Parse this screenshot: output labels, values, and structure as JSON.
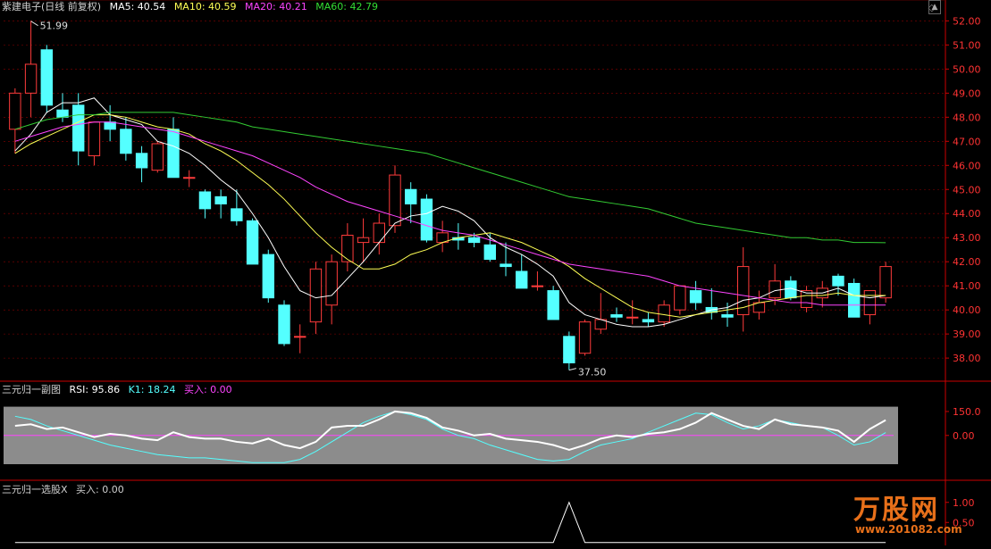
{
  "title": {
    "stock": "紫建电子(日线 前复权)",
    "ma5_label": "MA5: 40.54",
    "ma10_label": "MA10: 40.59",
    "ma20_label": "MA20: 40.21",
    "ma60_label": "MA60: 42.79"
  },
  "sub1": {
    "name": "三元归一副图",
    "rsi": "RSI: 95.86",
    "k1": "K1: 18.24",
    "buy": "买入: 0.00"
  },
  "sub2": {
    "name": "三元归一选股X",
    "buy": "买入: 0.00"
  },
  "brand": {
    "name": "万股网",
    "url": "www.201082.com"
  },
  "colors": {
    "up": "#ff3b3b",
    "down": "#54ffff",
    "ma5": "#ffffff",
    "ma10": "#ffff55",
    "ma20": "#ff44ff",
    "ma60": "#33cc33",
    "axis": "#cc0000"
  },
  "chart_data": [
    {
      "type": "candlestick",
      "title": "紫建电子(日线 前复权)",
      "y_ticks": [
        "52.00",
        "51.00",
        "50.00",
        "49.00",
        "48.00",
        "47.00",
        "46.00",
        "45.00",
        "44.00",
        "43.00",
        "42.00",
        "41.00",
        "40.00",
        "39.00",
        "38.00"
      ],
      "ylim": [
        37.3,
        52.2
      ],
      "annotations": [
        {
          "text": "51.99",
          "value": 51.99
        },
        {
          "text": "37.50",
          "value": 37.5
        }
      ],
      "candles": [
        [
          47.5,
          49.2,
          46.5,
          49.0
        ],
        [
          49.0,
          52.0,
          48.0,
          50.2
        ],
        [
          50.8,
          51.0,
          48.2,
          48.5
        ],
        [
          48.3,
          49.0,
          47.8,
          48.0
        ],
        [
          48.5,
          49.0,
          46.0,
          46.6
        ],
        [
          46.4,
          47.8,
          46.0,
          47.8
        ],
        [
          47.8,
          48.5,
          47.0,
          47.5
        ],
        [
          47.5,
          48.0,
          46.2,
          46.5
        ],
        [
          46.5,
          46.8,
          45.3,
          45.9
        ],
        [
          45.8,
          47.0,
          45.7,
          46.9
        ],
        [
          47.5,
          48.0,
          45.5,
          45.5
        ],
        [
          45.5,
          45.8,
          45.1,
          45.5
        ],
        [
          44.9,
          45.0,
          43.8,
          44.2
        ],
        [
          44.7,
          45.0,
          43.8,
          44.4
        ],
        [
          44.2,
          45.0,
          43.5,
          43.7
        ],
        [
          43.7,
          43.8,
          41.9,
          41.9
        ],
        [
          42.3,
          42.5,
          40.3,
          40.5
        ],
        [
          40.2,
          40.4,
          38.5,
          38.6
        ],
        [
          38.9,
          39.4,
          38.2,
          38.9
        ],
        [
          39.5,
          42.0,
          39.0,
          41.7
        ],
        [
          40.2,
          42.3,
          39.4,
          42.0
        ],
        [
          42.0,
          43.6,
          41.6,
          43.1
        ],
        [
          42.8,
          43.8,
          42.0,
          43.0
        ],
        [
          42.8,
          44.0,
          42.3,
          43.6
        ],
        [
          43.5,
          46.0,
          43.2,
          45.6
        ],
        [
          45.0,
          45.3,
          43.6,
          44.4
        ],
        [
          44.6,
          44.8,
          42.8,
          42.9
        ],
        [
          42.8,
          43.7,
          42.4,
          43.2
        ],
        [
          43.0,
          43.6,
          42.5,
          42.9
        ],
        [
          43.0,
          43.2,
          42.6,
          42.8
        ],
        [
          42.7,
          43.2,
          42.0,
          42.1
        ],
        [
          41.9,
          42.8,
          41.4,
          41.8
        ],
        [
          41.6,
          42.3,
          40.9,
          40.9
        ],
        [
          41.0,
          41.6,
          40.8,
          41.0
        ],
        [
          40.8,
          41.0,
          39.6,
          39.6
        ],
        [
          38.9,
          39.1,
          37.5,
          37.8
        ],
        [
          38.2,
          39.6,
          38.1,
          39.5
        ],
        [
          39.2,
          40.7,
          39.0,
          39.6
        ],
        [
          39.8,
          40.1,
          39.5,
          39.7
        ],
        [
          39.7,
          40.4,
          39.4,
          39.7
        ],
        [
          39.6,
          39.9,
          39.3,
          39.5
        ],
        [
          39.5,
          40.4,
          39.3,
          40.2
        ],
        [
          40.0,
          41.0,
          39.8,
          41.0
        ],
        [
          40.8,
          41.2,
          40.0,
          40.3
        ],
        [
          40.1,
          40.9,
          39.6,
          39.9
        ],
        [
          39.8,
          40.3,
          39.3,
          39.7
        ],
        [
          39.8,
          42.6,
          39.1,
          41.8
        ],
        [
          39.9,
          40.8,
          39.6,
          40.3
        ],
        [
          40.5,
          41.9,
          40.2,
          41.2
        ],
        [
          41.2,
          41.4,
          40.4,
          40.5
        ],
        [
          40.1,
          41.0,
          39.9,
          40.8
        ],
        [
          40.5,
          41.2,
          40.1,
          40.9
        ],
        [
          41.4,
          41.5,
          40.6,
          41.0
        ],
        [
          41.1,
          41.3,
          39.7,
          39.7
        ],
        [
          39.8,
          40.8,
          39.4,
          40.8
        ],
        [
          40.5,
          42.0,
          40.3,
          41.8
        ]
      ],
      "series": [
        {
          "name": "MA5",
          "values": [
            46.6,
            47.3,
            48.2,
            48.6,
            48.6,
            48.8,
            48.1,
            47.9,
            47.7,
            47.0,
            46.8,
            46.5,
            46.0,
            45.4,
            44.9,
            44.0,
            43.0,
            41.8,
            40.8,
            40.5,
            40.6,
            41.3,
            42.0,
            42.8,
            43.6,
            43.9,
            44.0,
            44.3,
            44.1,
            43.7,
            43.0,
            42.6,
            42.3,
            41.9,
            41.4,
            40.3,
            39.8,
            39.6,
            39.4,
            39.3,
            39.3,
            39.4,
            39.6,
            39.8,
            40.0,
            40.1,
            40.4,
            40.5,
            40.8,
            40.9,
            40.7,
            40.7,
            40.9,
            40.6,
            40.5,
            40.6
          ]
        },
        {
          "name": "MA10",
          "values": [
            46.5,
            46.9,
            47.2,
            47.5,
            47.8,
            48.1,
            48.1,
            48.0,
            47.8,
            47.6,
            47.5,
            47.3,
            46.9,
            46.6,
            46.2,
            45.7,
            45.2,
            44.6,
            43.9,
            43.2,
            42.6,
            42.1,
            41.7,
            41.7,
            41.9,
            42.3,
            42.5,
            42.8,
            43.0,
            43.1,
            43.2,
            43.0,
            42.8,
            42.5,
            42.2,
            41.8,
            41.3,
            40.9,
            40.5,
            40.1,
            39.9,
            39.8,
            39.7,
            39.8,
            39.9,
            40.0,
            40.1,
            40.3,
            40.4,
            40.5,
            40.6,
            40.6,
            40.7,
            40.6,
            40.6,
            40.6
          ]
        },
        {
          "name": "MA20",
          "values": [
            47.0,
            47.2,
            47.4,
            47.6,
            47.7,
            47.8,
            47.8,
            47.7,
            47.6,
            47.5,
            47.4,
            47.2,
            47.0,
            46.8,
            46.6,
            46.4,
            46.1,
            45.8,
            45.5,
            45.1,
            44.8,
            44.5,
            44.3,
            44.1,
            43.9,
            43.7,
            43.5,
            43.3,
            43.2,
            43.1,
            42.9,
            42.7,
            42.5,
            42.3,
            42.1,
            41.9,
            41.8,
            41.7,
            41.6,
            41.5,
            41.4,
            41.2,
            41.0,
            40.9,
            40.8,
            40.7,
            40.6,
            40.5,
            40.4,
            40.3,
            40.3,
            40.2,
            40.2,
            40.2,
            40.2,
            40.2
          ]
        },
        {
          "name": "MA60",
          "values": [
            47.5,
            47.7,
            47.9,
            48.0,
            48.1,
            48.1,
            48.2,
            48.2,
            48.2,
            48.2,
            48.2,
            48.1,
            48.0,
            47.9,
            47.8,
            47.6,
            47.5,
            47.4,
            47.3,
            47.2,
            47.1,
            47.0,
            46.9,
            46.8,
            46.7,
            46.6,
            46.5,
            46.3,
            46.1,
            45.9,
            45.7,
            45.5,
            45.3,
            45.1,
            44.9,
            44.7,
            44.6,
            44.5,
            44.4,
            44.3,
            44.2,
            44.0,
            43.8,
            43.6,
            43.5,
            43.4,
            43.3,
            43.2,
            43.1,
            43.0,
            43.0,
            42.9,
            42.9,
            42.8,
            42.8,
            42.79
          ]
        }
      ]
    },
    {
      "type": "line",
      "title": "三元归一副图",
      "y_ticks": [
        "150.0",
        "0.00"
      ],
      "ylim": [
        -180,
        200
      ],
      "band": [
        -180,
        180
      ],
      "series": [
        {
          "name": "RSI",
          "values": [
            60,
            70,
            40,
            50,
            20,
            -10,
            10,
            0,
            -20,
            -30,
            20,
            -10,
            -20,
            -20,
            -40,
            -50,
            -20,
            -60,
            -80,
            -40,
            50,
            60,
            60,
            100,
            150,
            140,
            110,
            50,
            30,
            0,
            10,
            -20,
            -30,
            -40,
            -60,
            -90,
            -60,
            -20,
            0,
            -10,
            10,
            20,
            40,
            80,
            140,
            100,
            60,
            40,
            100,
            70,
            60,
            50,
            30,
            -40,
            40,
            95.86
          ]
        },
        {
          "name": "K1",
          "values": [
            120,
            100,
            60,
            30,
            0,
            -30,
            -60,
            -80,
            -100,
            -120,
            -130,
            -140,
            -140,
            -150,
            -160,
            -170,
            -170,
            -170,
            -150,
            -100,
            -40,
            20,
            80,
            120,
            150,
            130,
            100,
            40,
            0,
            -20,
            -60,
            -90,
            -120,
            -150,
            -160,
            -150,
            -100,
            -60,
            -40,
            -20,
            20,
            60,
            100,
            140,
            130,
            80,
            40,
            60,
            100,
            80,
            60,
            50,
            0,
            -60,
            -40,
            18.24
          ]
        },
        {
          "name": "买入",
          "values": [
            0,
            0,
            0,
            0,
            0,
            0,
            0,
            0,
            0,
            0,
            0,
            0,
            0,
            0,
            0,
            0,
            0,
            0,
            0,
            0,
            0,
            0,
            0,
            0,
            0,
            0,
            0,
            0,
            0,
            0,
            0,
            0,
            0,
            0,
            0,
            0,
            0,
            0,
            0,
            0,
            0,
            0,
            0,
            0,
            0,
            0,
            0,
            0,
            0,
            0,
            0,
            0,
            0,
            0,
            0,
            0
          ]
        }
      ]
    },
    {
      "type": "line",
      "title": "三元归一选股X",
      "y_ticks": [
        "1.00",
        "0.50"
      ],
      "ylim": [
        -0.05,
        1.15
      ],
      "series": [
        {
          "name": "买入",
          "values": [
            0,
            0,
            0,
            0,
            0,
            0,
            0,
            0,
            0,
            0,
            0,
            0,
            0,
            0,
            0,
            0,
            0,
            0,
            0,
            0,
            0,
            0,
            0,
            0,
            0,
            0,
            0,
            0,
            0,
            0,
            0,
            0,
            0,
            0,
            0,
            1,
            0,
            0,
            0,
            0,
            0,
            0,
            0,
            0,
            0,
            0,
            0,
            0,
            0,
            0,
            0,
            0,
            0,
            0,
            0,
            0
          ]
        }
      ]
    }
  ]
}
